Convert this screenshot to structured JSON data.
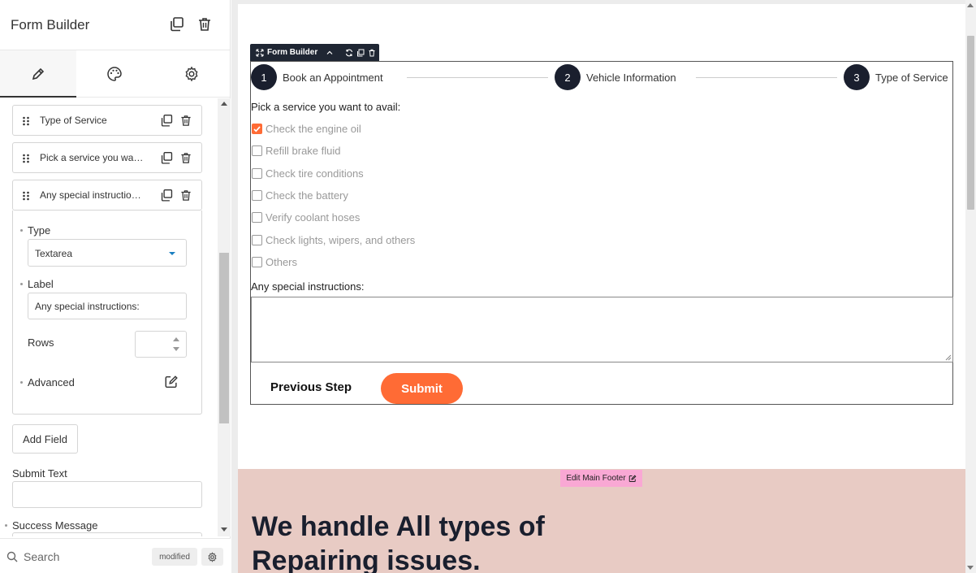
{
  "sidebar": {
    "title": "Form Builder",
    "tabs": [
      {
        "name": "content",
        "icon": "pencil-icon"
      },
      {
        "name": "style",
        "icon": "palette-icon"
      },
      {
        "name": "advanced",
        "icon": "gear-icon"
      }
    ],
    "fields": [
      {
        "label": "Type of Service"
      },
      {
        "label": "Pick a service you want to avail:"
      },
      {
        "label": "Any special instructions:"
      }
    ],
    "expanded": {
      "type_label": "Type",
      "type_value": "Textarea",
      "label_label": "Label",
      "label_value": "Any special instructions:",
      "rows_label": "Rows",
      "advanced_label": "Advanced"
    },
    "add_field": "Add Field",
    "submit_text_label": "Submit Text",
    "success_message_label": "Success Message",
    "footer": {
      "search": "Search",
      "badge": "modified"
    }
  },
  "canvas": {
    "toolbar_title": "Form Builder",
    "steps": [
      {
        "num": "1",
        "label": "Book an Appointment"
      },
      {
        "num": "2",
        "label": "Vehicle Information"
      },
      {
        "num": "3",
        "label": "Type of Service"
      }
    ],
    "question": "Pick a service you want to avail:",
    "options": [
      {
        "label": "Check the engine oil",
        "checked": true
      },
      {
        "label": "Refill brake fluid",
        "checked": false
      },
      {
        "label": "Check tire conditions",
        "checked": false
      },
      {
        "label": "Check the battery",
        "checked": false
      },
      {
        "label": "Verify coolant hoses",
        "checked": false
      },
      {
        "label": "Check lights, wipers, and others",
        "checked": false
      },
      {
        "label": "Others",
        "checked": false
      }
    ],
    "instructions_label": "Any special instructions:",
    "prev_button": "Previous Step",
    "submit_button": "Submit",
    "edit_footer": "Edit Main Footer",
    "hero_text": "We handle All types of Repairing issues."
  },
  "colors": {
    "accent": "#ff6b35",
    "dark": "#1a1f2e",
    "footer_bg": "#e8cbc4",
    "edit_badge": "#f9a8d4"
  }
}
